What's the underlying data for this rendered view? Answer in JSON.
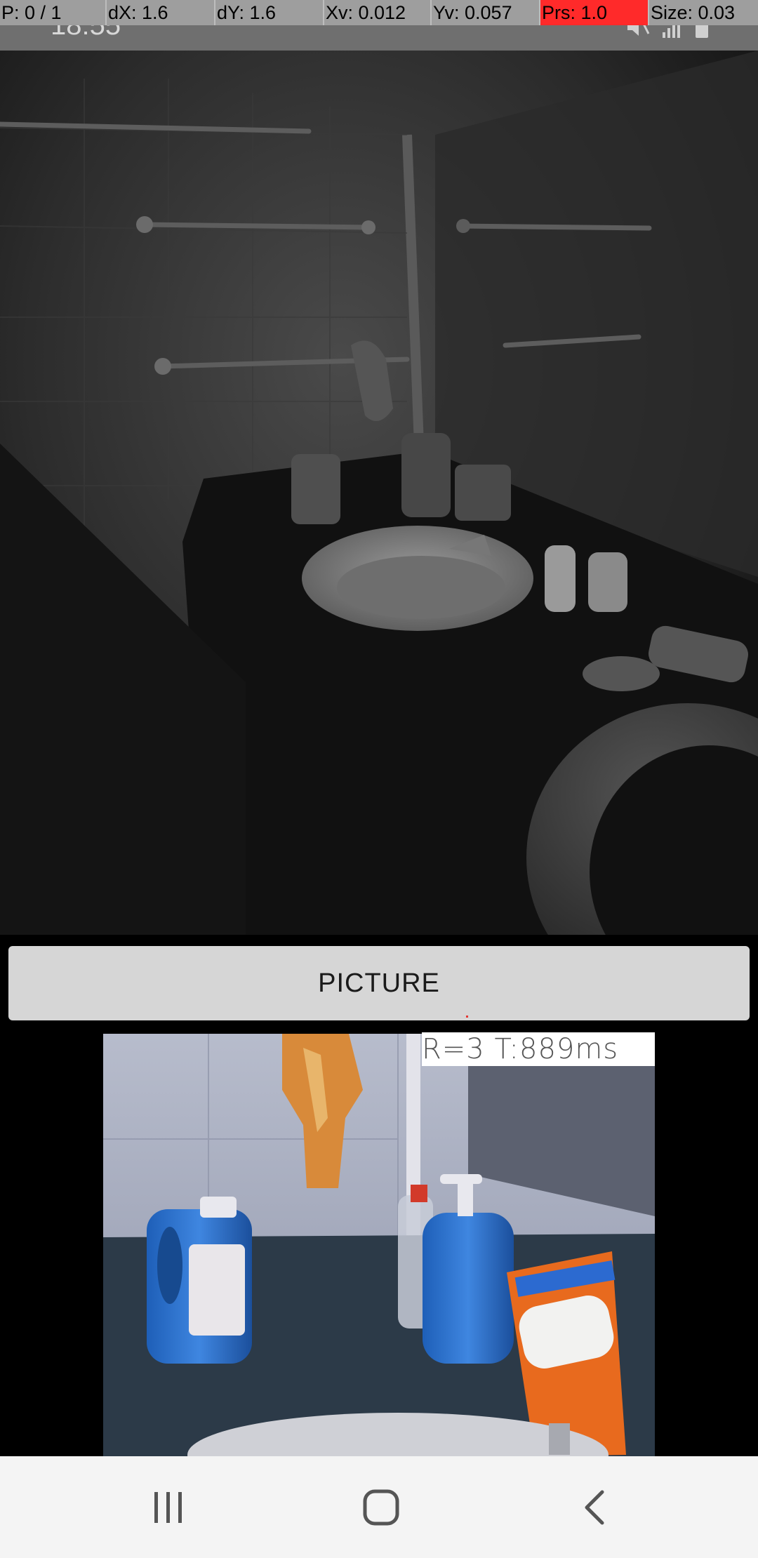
{
  "debug_overlay": {
    "pointer": "P: 0 / 1",
    "dx": "dX: 1.6",
    "dy": "dY: 1.6",
    "xv": "Xv: 0.012",
    "yv": "Yv: 0.057",
    "pressure": "Prs: 1.0",
    "size": "Size: 0.03",
    "pressure_color": "#ff2a2a"
  },
  "status_bar": {
    "time": "18:55",
    "icons": [
      "mute-icon",
      "signal-icon",
      "battery-icon"
    ]
  },
  "camera": {
    "button_label": "PICTURE"
  },
  "result": {
    "label": "R=3  T:889ms"
  },
  "nav_bar": {
    "buttons": [
      "recent-apps-icon",
      "home-icon",
      "back-icon"
    ]
  },
  "colors": {
    "nav_background": "#f4f4f4",
    "button_background": "#d6d6d6",
    "debug_background": "#9e9e9e"
  }
}
